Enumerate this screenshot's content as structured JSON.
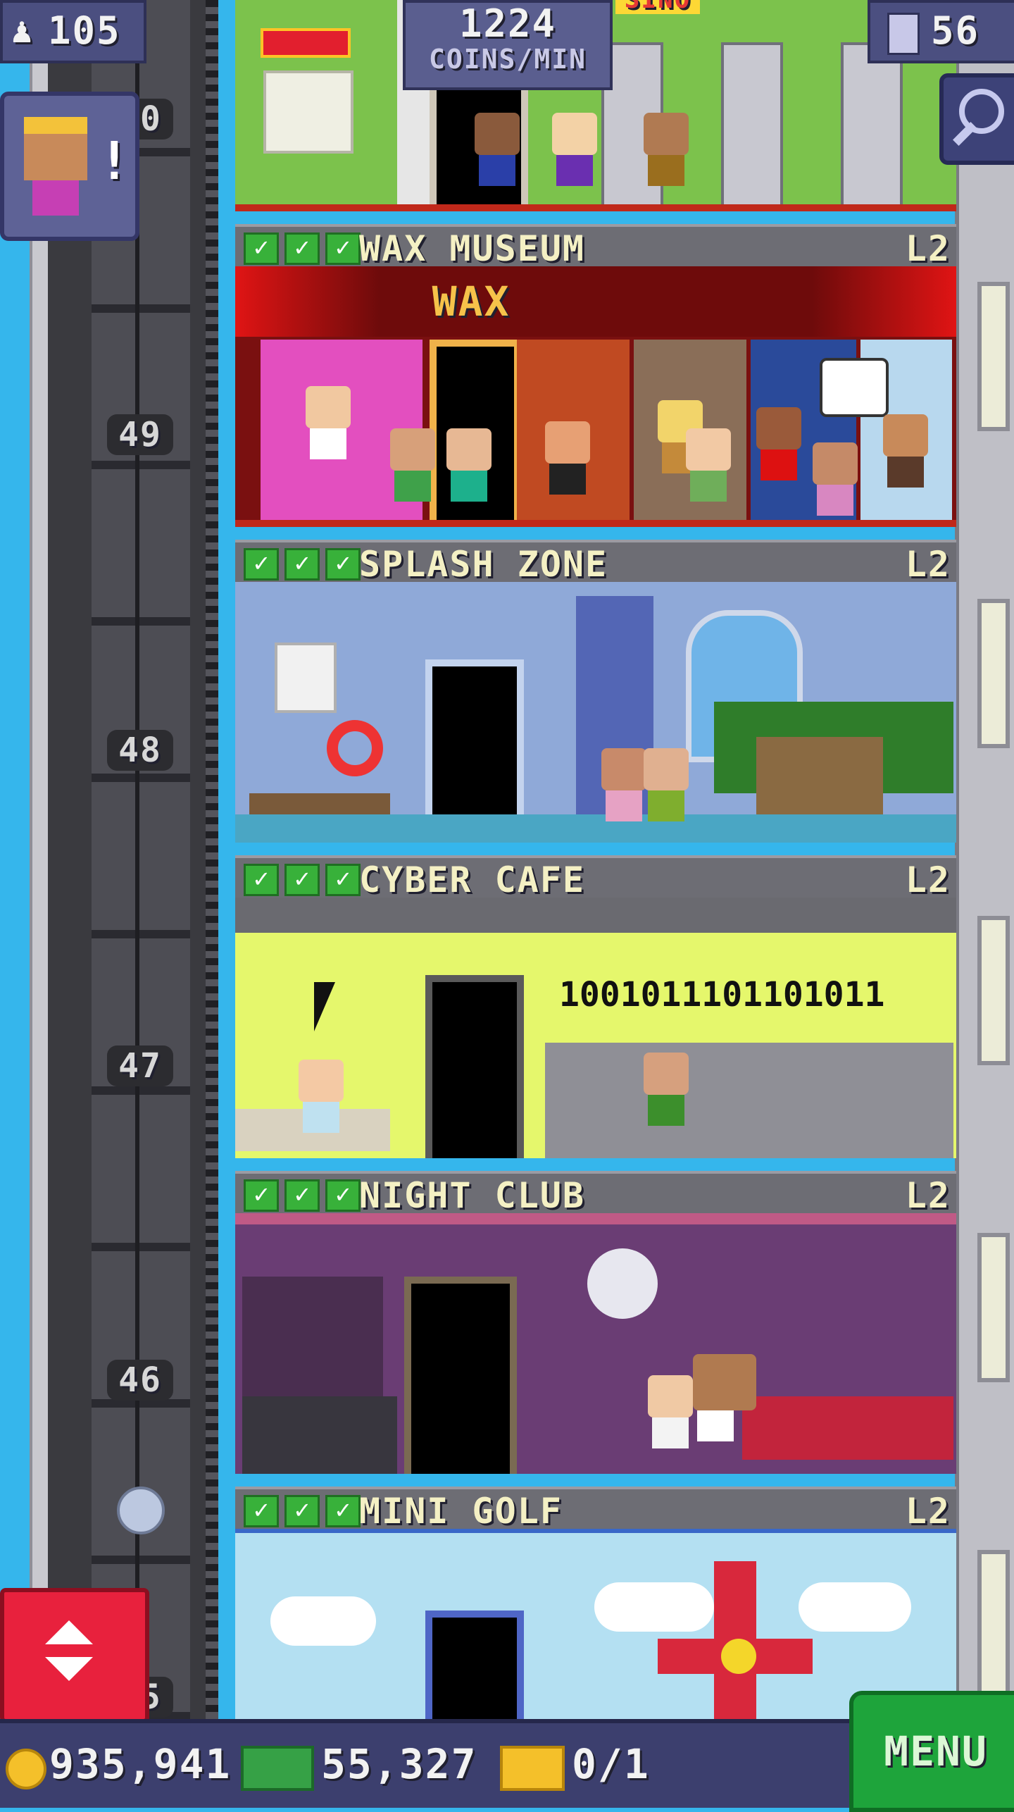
{
  "hud": {
    "population": "105",
    "coins_per_min_value": "1224",
    "coins_per_min_label": "COINS/MIN",
    "floor_count": "56"
  },
  "shaft": {
    "floor_numbers": [
      "50",
      "49",
      "48",
      "47",
      "46",
      "45"
    ]
  },
  "casino_sign": "SINO",
  "floors": [
    {
      "name": "WAX MUSEUM",
      "level": "L2",
      "sign": "WAX"
    },
    {
      "name": "SPLASH ZONE",
      "level": "L2"
    },
    {
      "name": "CYBER CAFE",
      "level": "L2",
      "binary": "1001011101101011"
    },
    {
      "name": "NIGHT CLUB",
      "level": "L2"
    },
    {
      "name": "MINI GOLF",
      "level": "L2"
    }
  ],
  "bottom": {
    "coins": "935,941",
    "bux": "55,327",
    "tickets": "0/1",
    "menu_label": "MENU"
  },
  "notification": {
    "mark": "!"
  },
  "colors": {
    "sky": "#35b6ec",
    "hud_purple": "#4b4f80",
    "menu_green": "#1ea43b",
    "elevator_red": "#e8213d",
    "label_text": "#f4f0c4"
  }
}
